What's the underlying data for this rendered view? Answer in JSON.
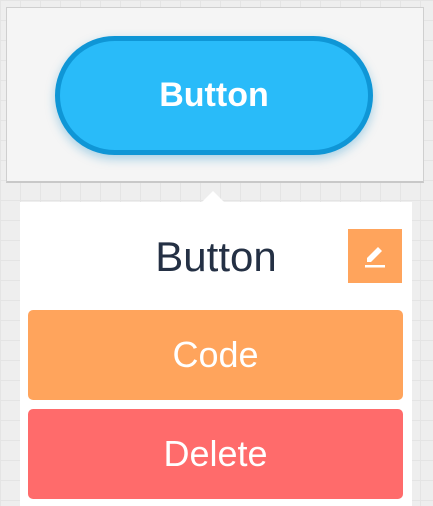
{
  "preview": {
    "button_label": "Button",
    "button_color": "#29bbf9",
    "button_border_color": "#0f96d6"
  },
  "popup": {
    "title": "Button",
    "edit_icon": "pencil-icon",
    "code_label": "Code",
    "delete_label": "Delete",
    "colors": {
      "edit": "#ffa45c",
      "code": "#ffa45c",
      "delete": "#ff6b6b",
      "title_text": "#243044"
    }
  }
}
